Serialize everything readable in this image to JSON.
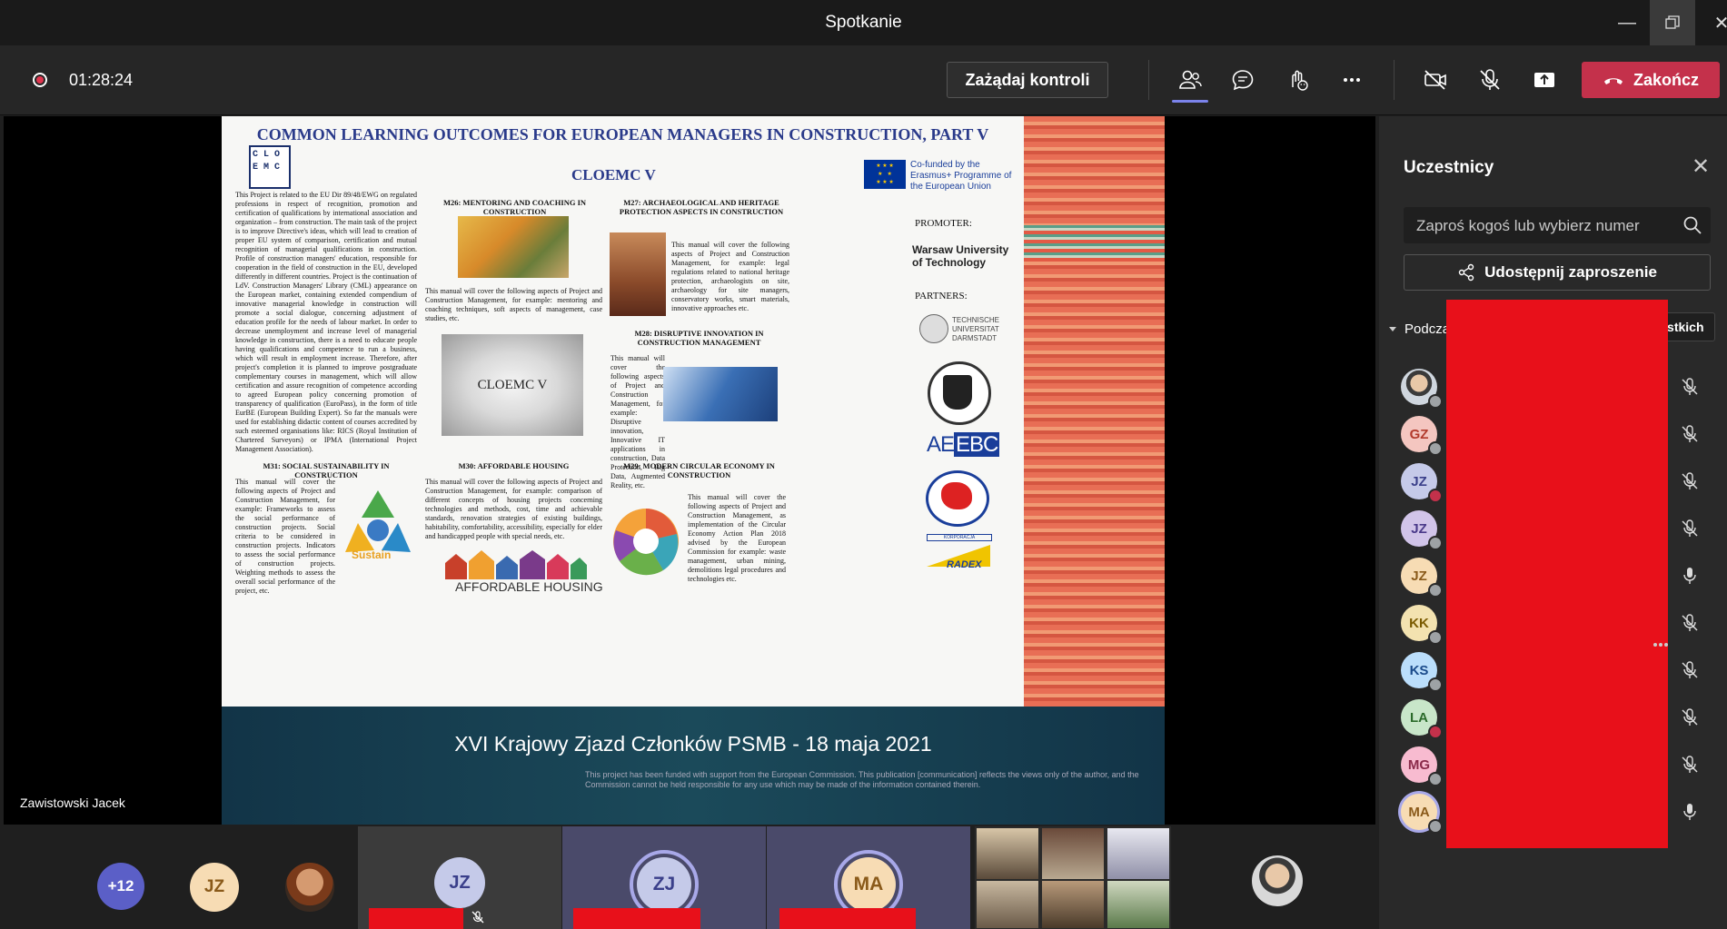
{
  "window": {
    "title": "Spotkanie"
  },
  "toolbar": {
    "timer": "01:28:24",
    "request_control_label": "Zażądaj kontroli",
    "end_label": "Zakończ"
  },
  "slide": {
    "main_title": "COMMON LEARNING OUTCOMES FOR EUROPEAN MANAGERS IN CONSTRUCTION, PART V",
    "subtitle": "CLOEMC V",
    "logo_text": "C L O E M C",
    "eu_text": "Co-funded by the Erasmus+ Programme of the European Union",
    "intro_text": "This Project is related to the EU Dir 89/48/EWG on regulated professions in respect of recognition, promotion and certification of qualifications by international association and organization – from construction. The main task of the project is to improve Directive's ideas, which will lead to creation of proper EU system of comparison, certification and mutual recognition of managerial qualifications in construction. Profile of construction managers' education, responsible for cooperation in the field of construction in the EU, developed differently in different countries. Project is the continuation of LdV. Construction Managers' Library (CML) appearance on the European market, containing extended compendium of innovative managerial knowledge in construction will promote a social dialogue, concerning adjustment of education profile for the needs of labour market. In order to decrease unemployment and increase level of managerial knowledge in construction, there is a need to educate people having qualifications and competence to run a business, which will result in employment increase. Therefore, after project's completion it is planned to improve postgraduate complementary courses in management, which will allow certification and assure recognition of competence according to agreed European policy concerning promotion of transparency of qualification (EuroPass), in the form of title EurBE (European Building Expert). So far the manuals were used for establishing didactic content of courses accredited by such esteemed organisations like: RICS (Royal Institution of Chartered Surveyors) or IPMA (International Project Management Association).",
    "m26_title": "M26: MENTORING AND COACHING IN CONSTRUCTION",
    "m26_text": "This manual will cover the following aspects of Project and Construction Management, for example: mentoring and coaching techniques, soft aspects of management, case studies, etc.",
    "m27_title": "M27: ARCHAEOLOGICAL AND HERITAGE PROTECTION ASPECTS IN CONSTRUCTION",
    "m27_text": "This manual will cover the following aspects of Project and Construction Management, for example: legal regulations related to national heritage protection, archaeologists on site, archaeology for site managers, conservatory works, smart materials, innovative approaches etc.",
    "center_image_label": "CLOEMC V",
    "m28_title": "M28: DISRUPTIVE INNOVATION IN CONSTRUCTION MANAGEMENT",
    "m28_text": "This manual will cover the following aspects of Project and Construction Management, for example: Disruptive innovation, Innovative IT applications in construction, Data Protection, Big Data, Augmented Reality, etc.",
    "m31_title": "M31: SOCIAL SUSTAINABILITY IN CONSTRUCTION",
    "m31_text": "This manual will cover the following aspects of Project and Construction Management, for example: Frameworks to assess the social performance of construction projects. Social criteria to be considered in construction projects. Indicators to assess the social performance of construction projects. Weighting methods to assess the overall social performance of the project, etc.",
    "sustain_label": "Sustain",
    "m30_title": "M30: AFFORDABLE HOUSING",
    "m30_text": "This manual will cover the following aspects of Project and Construction Management, for example: comparison of different concepts of housing projects concerning technologies and methods, cost, time and achievable standards, renovation strategies of existing buildings, habitability, comfortability, accessibility, especially for elder and handicapped people with special needs, etc.",
    "affordable_label": "AFFORDABLE HOUSING",
    "m29_title": "M29: MODERN CIRCULAR ECONOMY IN CONSTRUCTION",
    "m29_text": "This manual will cover the following aspects of Project and Construction Management, as implementation of the Circular Economy Action Plan 2018 advised by the European Commission for example: waste management, urban mining, demolitions legal procedures and technologies etc.",
    "promoter_label": "PROMOTER:",
    "promoter_name": "Warsaw University of Technology",
    "partners_label": "PARTNERS:",
    "tu_name": "TECHNISCHE UNIVERSITAT DARMSTADT",
    "aeebc_left": "AE",
    "aeebc_right": "EBC",
    "radex_top": "KORPORACJA",
    "radex_name": "RADEX",
    "event_title": "XVI Krajowy Zjazd Członków PSMB - 18 maja 2021",
    "disclaimer": "This project has been funded with support from the European Commission. This publication [communication] reflects the views only of the author, and the Commission cannot be held responsible for any use which may be made of the information contained therein."
  },
  "presenter": {
    "name": "Zawistowski Jacek"
  },
  "strip": {
    "overflow_count": "+12",
    "tiles": [
      {
        "initials": "JZ"
      },
      {
        "initials": "JZ"
      },
      {
        "initials": "ZJ"
      },
      {
        "initials": "MA"
      }
    ]
  },
  "panel": {
    "title": "Uczestnicy",
    "search_placeholder": "Zaproś kogoś lub wybierz numer",
    "share_label": "Udostępnij zaproszenie",
    "section_label": "Podczas tego spotkania (18)",
    "mute_all_label": "Wycisz wszystkich",
    "participants": [
      {
        "initials": "",
        "avatar_color": "#cfd6de",
        "status": "#9ea2a5",
        "mic": "muted"
      },
      {
        "initials": "GZ",
        "avatar_color": "#f4c6c0",
        "text_color": "#b23a2c",
        "status": "#9ea2a5",
        "mic": "muted"
      },
      {
        "initials": "JZ",
        "avatar_color": "#c5cae9",
        "text_color": "#3a3f8a",
        "status": "#c4314b",
        "mic": "muted"
      },
      {
        "initials": "JZ",
        "avatar_color": "#d1c4e9",
        "text_color": "#4a3a8a",
        "status": "#9ea2a5",
        "mic": "muted"
      },
      {
        "initials": "JZ",
        "avatar_color": "#f7dcb4",
        "text_color": "#8a5a1a",
        "status": "#9ea2a5",
        "mic": "on"
      },
      {
        "initials": "KK",
        "avatar_color": "#f3e2b0",
        "text_color": "#7a5a00",
        "status": "#9ea2a5",
        "mic": "muted"
      },
      {
        "initials": "KS",
        "avatar_color": "#bbdefb",
        "text_color": "#1a4a8a",
        "status": "#9ea2a5",
        "mic": "muted"
      },
      {
        "initials": "LA",
        "avatar_color": "#c8e6c9",
        "text_color": "#2a6a2a",
        "status": "#c4314b",
        "mic": "muted"
      },
      {
        "initials": "MG",
        "avatar_color": "#f8bbd0",
        "text_color": "#8a2a4a",
        "status": "#9ea2a5",
        "mic": "muted"
      },
      {
        "initials": "MA",
        "avatar_color": "#f7dcb4",
        "text_color": "#8a5a1a",
        "status": "#9ea2a5",
        "mic": "on"
      }
    ]
  },
  "colors": {
    "accent": "#7b83eb",
    "end": "#c4314b",
    "redaction": "#e8101a"
  }
}
